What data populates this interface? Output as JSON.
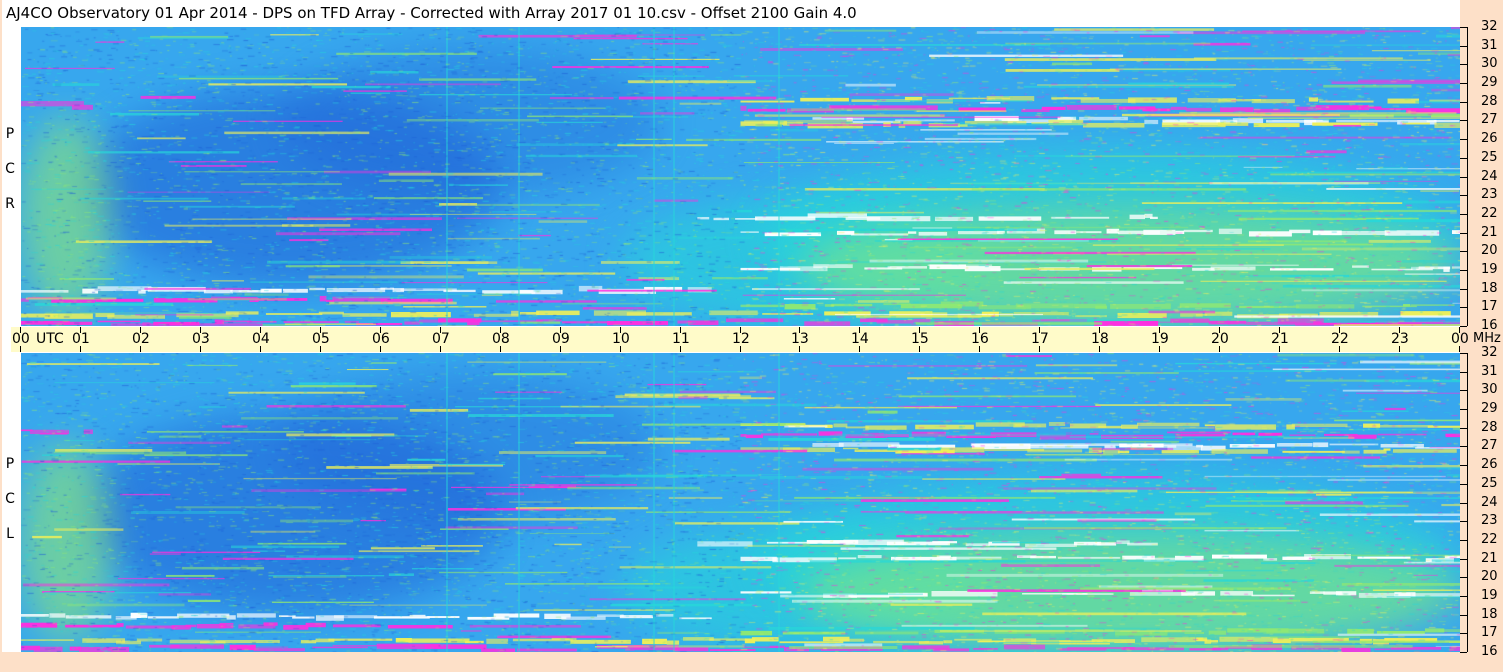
{
  "title": "AJ4CO Observatory  01 Apr 2014  -  DPS on TFD Array  -  Corrected with Array 2017 01 10.csv  -  Offset 2100  Gain 4.0",
  "chart_data": [
    {
      "type": "heatmap",
      "panel_label": [
        "R",
        "C",
        "P"
      ],
      "x": [
        "00",
        "01",
        "02",
        "03",
        "04",
        "05",
        "06",
        "07",
        "08",
        "09",
        "10",
        "11",
        "12",
        "13",
        "14",
        "15",
        "16",
        "17",
        "18",
        "19",
        "20",
        "21",
        "22",
        "23",
        "00"
      ],
      "xlabel": "UTC",
      "y": [
        16,
        17,
        18,
        19,
        20,
        21,
        22,
        23,
        24,
        25,
        26,
        27,
        28,
        29,
        30,
        31,
        32
      ],
      "ylabel": "MHz",
      "ylim": [
        16,
        32
      ]
    },
    {
      "type": "heatmap",
      "panel_label": [
        "L",
        "C",
        "P"
      ],
      "x": [
        "00",
        "01",
        "02",
        "03",
        "04",
        "05",
        "06",
        "07",
        "08",
        "09",
        "10",
        "11",
        "12",
        "13",
        "14",
        "15",
        "16",
        "17",
        "18",
        "19",
        "20",
        "21",
        "22",
        "23",
        "00"
      ],
      "xlabel": "UTC",
      "y": [
        16,
        17,
        18,
        19,
        20,
        21,
        22,
        23,
        24,
        25,
        26,
        27,
        28,
        29,
        30,
        31,
        32
      ],
      "ylabel": "MHz",
      "ylim": [
        16,
        32
      ]
    }
  ],
  "time_axis": {
    "utc_label": "UTC",
    "unit_label": "MHz",
    "hours": [
      "00",
      "01",
      "02",
      "03",
      "04",
      "05",
      "06",
      "07",
      "08",
      "09",
      "10",
      "11",
      "12",
      "13",
      "14",
      "15",
      "16",
      "17",
      "18",
      "19",
      "20",
      "21",
      "22",
      "23",
      "00"
    ]
  },
  "colors": {
    "background_blue": "#37a7ee",
    "deep_blue": "#1f5fd6",
    "cyan": "#27d7d9",
    "green": "#8fe873",
    "yellow": "#eef05a",
    "magenta": "#ff2ee0",
    "white": "#ffffff",
    "axis_peach": "#fde0c8",
    "band_yellow": "#fffbc9"
  }
}
